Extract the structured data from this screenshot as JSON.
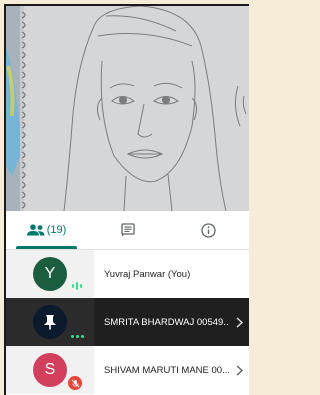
{
  "tabs": [
    {
      "label": "(19)",
      "icon": "people-icon",
      "active": true
    },
    {
      "label": "",
      "icon": "chat-icon",
      "active": false
    },
    {
      "label": "",
      "icon": "info-icon",
      "active": false
    }
  ],
  "participants": [
    {
      "initial": "Y",
      "name": "Yuvraj Panwar (You)",
      "avatar_color": "#1b5e3f",
      "status": "speaking-bars"
    },
    {
      "initial": "",
      "name": "SMRITA BHARDWAJ 00549...",
      "avatar_color": "#0b1a2c",
      "status": "presenting",
      "icon": "pin-icon"
    },
    {
      "initial": "S",
      "name": "SHIVAM MARUTI MANE 00...",
      "avatar_color": "#d23f5d",
      "status": "muted"
    }
  ],
  "colors": {
    "accent": "#00796b",
    "muted_badge": "#e8453c",
    "speaking": "#3ddc97"
  }
}
